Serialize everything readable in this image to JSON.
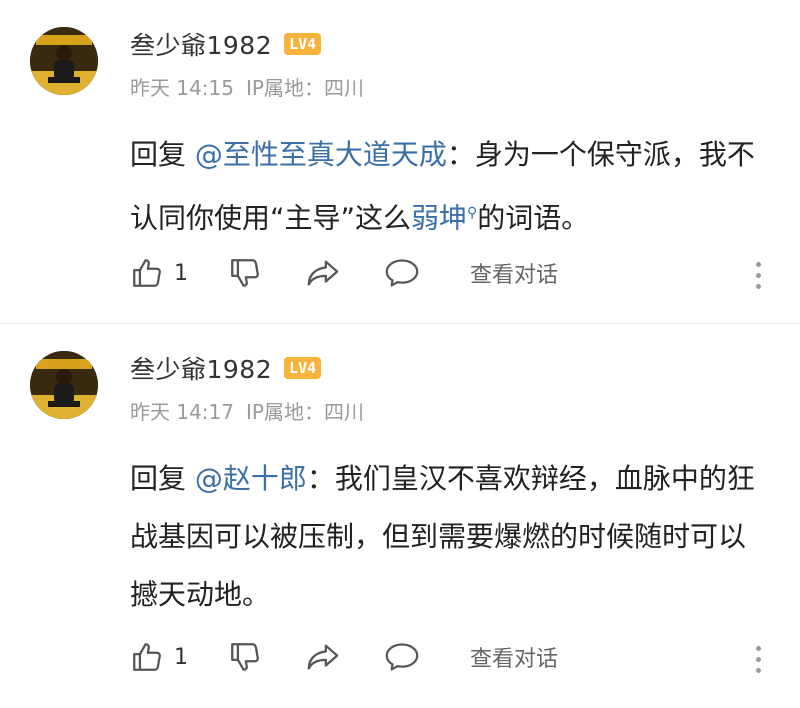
{
  "comments": [
    {
      "username": "叁少爺1982",
      "level": "LV4",
      "time": "昨天 14:15",
      "ip_location": "IP属地：四川",
      "reply_prefix": "回复 ",
      "mention": "@至性至真大道天成",
      "text_part1": "：身为一个保守派，我不认同你使用“主导”这么",
      "link_word": "弱坤",
      "text_part2": "的词语。",
      "like_count": "1",
      "view_thread": "查看对话"
    },
    {
      "username": "叁少爺1982",
      "level": "LV4",
      "time": "昨天 14:17",
      "ip_location": "IP属地：四川",
      "reply_prefix": "回复 ",
      "mention": "@赵十郎",
      "text_part1": "：我们皇汉不喜欢辩经，血脉中的狂战基因可以被压制，但到需要爆燃的时候随时可以撼天动地。",
      "like_count": "1",
      "view_thread": "查看对话"
    }
  ],
  "colors": {
    "mention": "#3a6fa8",
    "level_badge": "#f7b33b",
    "meta": "#9a9a9a"
  },
  "icons": [
    "thumbs-up-icon",
    "thumbs-down-icon",
    "share-icon",
    "comment-bubble-icon",
    "more-vertical-icon",
    "search-icon"
  ]
}
